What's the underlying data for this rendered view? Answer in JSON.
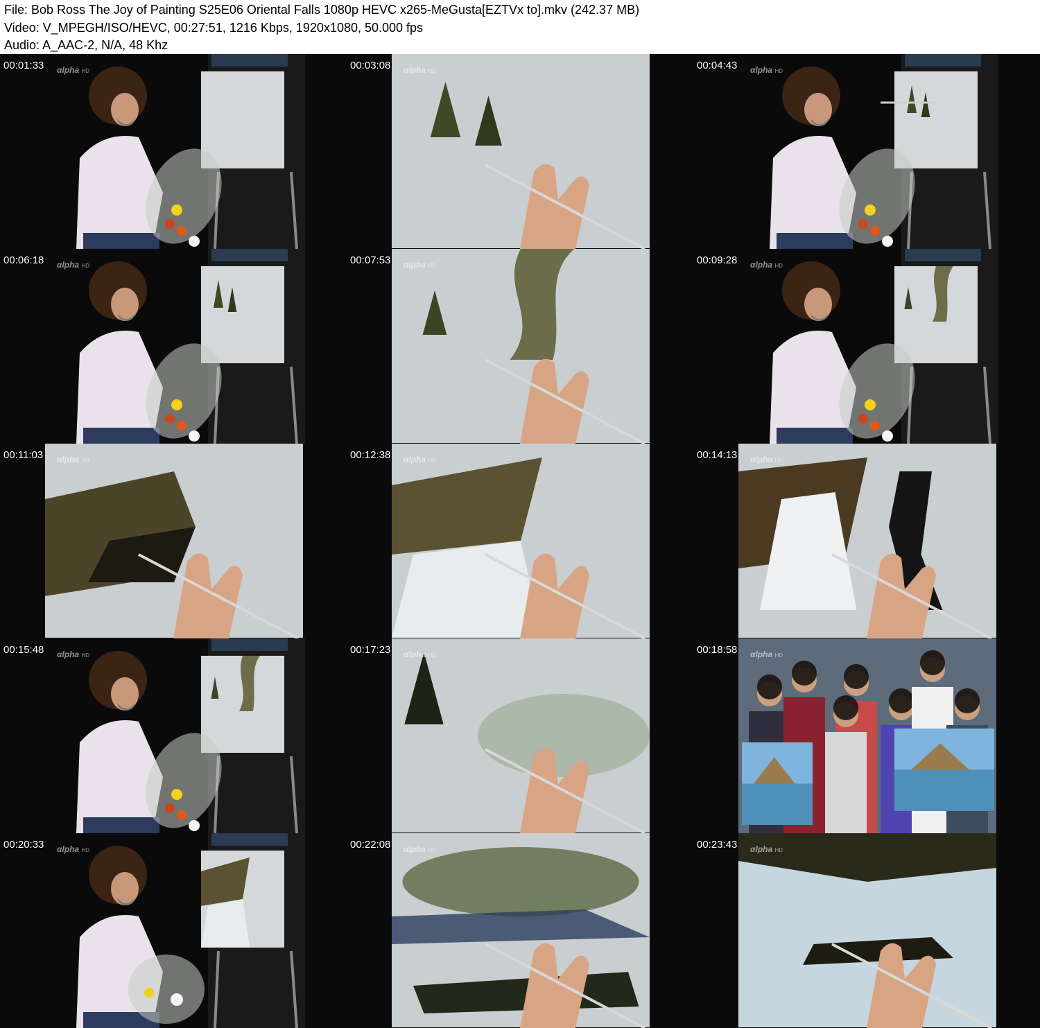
{
  "header": {
    "file_line": "File: Bob Ross The Joy of Painting S25E06 Oriental Falls 1080p HEVC x265-MeGusta[EZTVx to].mkv (242.37 MB)",
    "video_line": "Video: V_MPEGH/ISO/HEVC, 00:27:51, 1216 Kbps, 1920x1080, 50.000 fps",
    "audio_line": "Audio: A_AAC-2, N/A, 48 Khz"
  },
  "watermark": {
    "brand": "αlpha",
    "suffix": "HD"
  },
  "thumbnails": [
    {
      "timestamp": "00:01:33",
      "scene": "painter-palette",
      "canvas": "blank"
    },
    {
      "timestamp": "00:03:08",
      "scene": "closeup-canvas",
      "canvas": "trees"
    },
    {
      "timestamp": "00:04:43",
      "scene": "painter-knife",
      "canvas": "trees"
    },
    {
      "timestamp": "00:06:18",
      "scene": "painter-palette",
      "canvas": "trees"
    },
    {
      "timestamp": "00:07:53",
      "scene": "closeup-canvas",
      "canvas": "cliff"
    },
    {
      "timestamp": "00:09:28",
      "scene": "painter-palette",
      "canvas": "cliff"
    },
    {
      "timestamp": "00:11:03",
      "scene": "closeup-canvas",
      "canvas": "cliff-dark"
    },
    {
      "timestamp": "00:12:38",
      "scene": "closeup-canvas",
      "canvas": "falls"
    },
    {
      "timestamp": "00:14:13",
      "scene": "closeup-canvas",
      "canvas": "falls-dark"
    },
    {
      "timestamp": "00:15:48",
      "scene": "painter-palette",
      "canvas": "cliff"
    },
    {
      "timestamp": "00:17:23",
      "scene": "closeup-canvas",
      "canvas": "bushes"
    },
    {
      "timestamp": "00:18:58",
      "scene": "group-photo",
      "canvas": "landscape"
    },
    {
      "timestamp": "00:20:33",
      "scene": "painter-back",
      "canvas": "falls"
    },
    {
      "timestamp": "00:22:08",
      "scene": "closeup-canvas",
      "canvas": "bushes-dark"
    },
    {
      "timestamp": "00:23:43",
      "scene": "closeup-canvas",
      "canvas": "sky-dark"
    }
  ]
}
